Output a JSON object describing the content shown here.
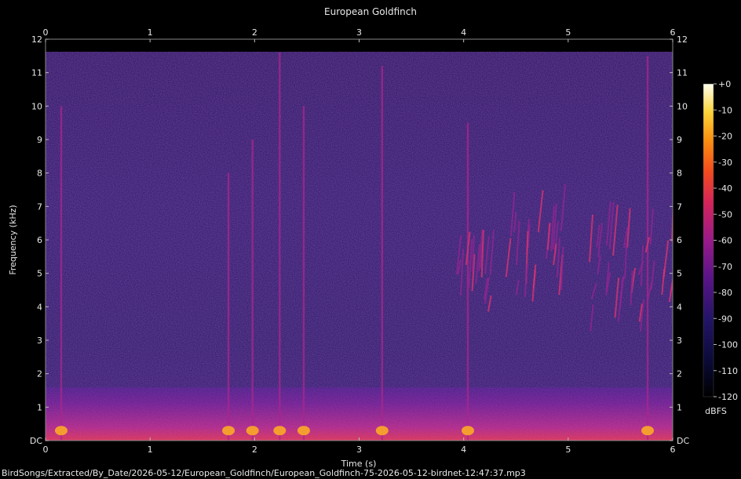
{
  "chart_data": {
    "type": "heatmap",
    "title": "European Goldfinch",
    "xlabel": "Time (s)",
    "ylabel": "Frequency (kHz)",
    "xlim": [
      0,
      6
    ],
    "ylim": [
      0,
      12
    ],
    "x_ticks": [
      "0",
      "1",
      "2",
      "3",
      "4",
      "5",
      "6"
    ],
    "y_ticks": [
      "DC",
      "1",
      "2",
      "3",
      "4",
      "5",
      "6",
      "7",
      "8",
      "9",
      "10",
      "11",
      "12"
    ],
    "colorbar": {
      "label": "dBFS",
      "range": [
        -120,
        0
      ],
      "ticks": [
        "+0",
        "-10",
        "-20",
        "-30",
        "-40",
        "-50",
        "-60",
        "-70",
        "-80",
        "-90",
        "-100",
        "-110",
        "-120"
      ]
    },
    "spectral_features": [
      {
        "kind": "broadband_click",
        "t": 0.15,
        "f_range": [
          0,
          10
        ]
      },
      {
        "kind": "broadband_click",
        "t": 1.75,
        "f_range": [
          0,
          8
        ]
      },
      {
        "kind": "broadband_click",
        "t": 1.98,
        "f_range": [
          0,
          9
        ]
      },
      {
        "kind": "broadband_click",
        "t": 2.24,
        "f_range": [
          0,
          11.6
        ]
      },
      {
        "kind": "broadband_click",
        "t": 2.47,
        "f_range": [
          0,
          10
        ]
      },
      {
        "kind": "broadband_click",
        "t": 3.22,
        "f_range": [
          0,
          11.2
        ]
      },
      {
        "kind": "broadband_click",
        "t": 4.04,
        "f_range": [
          0,
          9.5
        ]
      },
      {
        "kind": "broadband_click",
        "t": 5.76,
        "f_range": [
          0,
          11.5
        ]
      },
      {
        "kind": "song_burst",
        "t_range": [
          3.9,
          4.3
        ],
        "f_range": [
          3.8,
          6.3
        ]
      },
      {
        "kind": "song_burst",
        "t_range": [
          4.4,
          4.95
        ],
        "f_range": [
          3.9,
          8.2
        ]
      },
      {
        "kind": "song_burst",
        "t_range": [
          5.2,
          6.0
        ],
        "f_range": [
          3.2,
          7.8
        ]
      },
      {
        "kind": "low_freq_noise_band",
        "f_range": [
          0,
          1.6
        ]
      }
    ]
  },
  "footer": {
    "filepath": "BirdSongs/Extracted/By_Date/2026-05-12/European_Goldfinch/European_Goldfinch-75-2026-05-12-birdnet-12:47:37.mp3"
  }
}
